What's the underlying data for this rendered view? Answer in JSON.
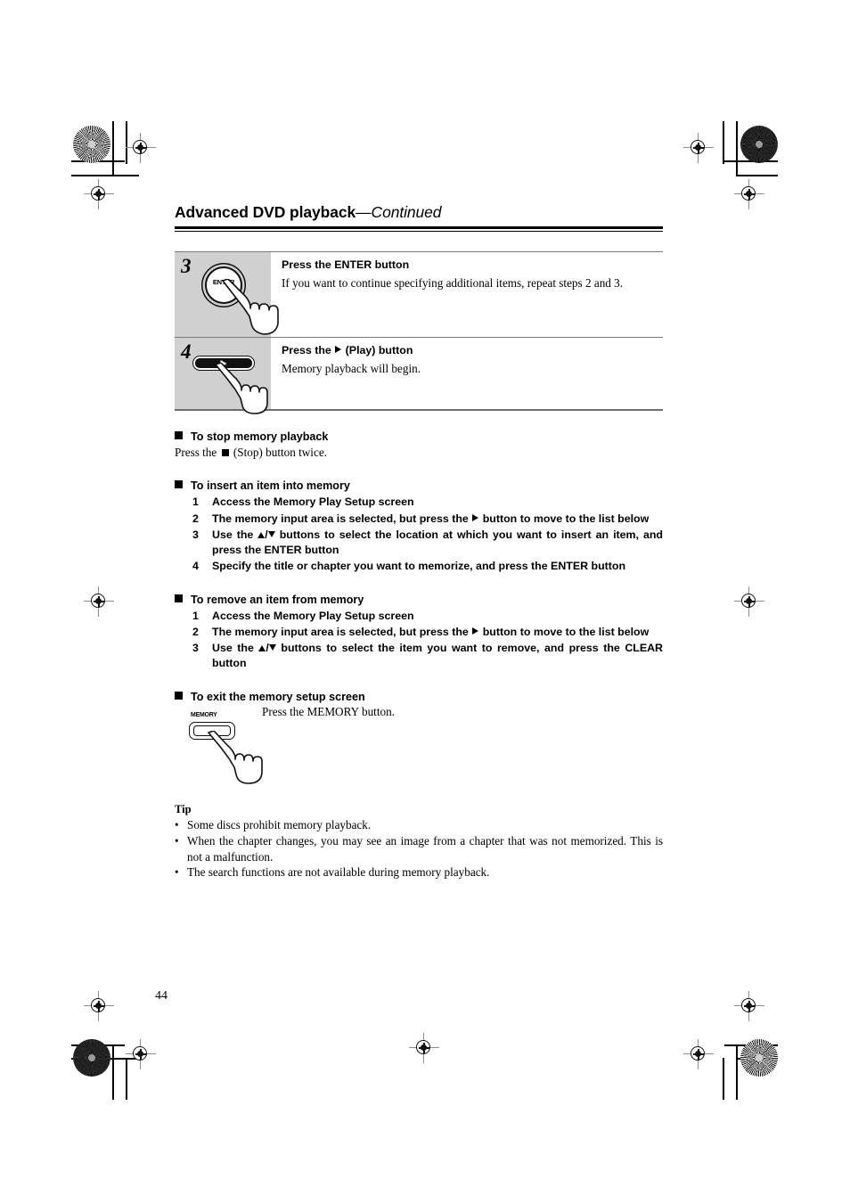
{
  "header": {
    "title": "Advanced DVD playback",
    "continued": "—Continued"
  },
  "steps": [
    {
      "number": "3",
      "title": "Press the ENTER button",
      "description": "If you want to continue specifying additional items, repeat steps 2 and 3.",
      "button_label": "ENTER"
    },
    {
      "number": "4",
      "title_prefix": "Press the ",
      "title_suffix": " (Play) button",
      "description": "Memory playback will begin."
    }
  ],
  "sections": [
    {
      "heading": "To stop memory playback",
      "body_prefix": "Press the ",
      "body_suffix": " (Stop) button twice."
    },
    {
      "heading": "To insert an item into memory",
      "items": [
        {
          "n": "1",
          "text": "Access the Memory Play Setup screen"
        },
        {
          "n": "2",
          "pre": "The memory input area is selected, but press the ",
          "post": " button to move to the list below",
          "glyph": "right-triangle"
        },
        {
          "n": "3",
          "pre": "Use the ",
          "post": " buttons to select the location at which you want to insert an item, and press the ENTER button",
          "glyph": "up-down-triangles"
        },
        {
          "n": "4",
          "text": "Specify the title or chapter you want to memorize, and press the ENTER button"
        }
      ]
    },
    {
      "heading": "To remove an item from memory",
      "items": [
        {
          "n": "1",
          "text": "Access the Memory Play Setup screen"
        },
        {
          "n": "2",
          "pre": "The memory input area is selected, but press the ",
          "post": " button to move to the list below",
          "glyph": "right-triangle"
        },
        {
          "n": "3",
          "pre": "Use the ",
          "post": " buttons to select the item you want to remove, and press the CLEAR button",
          "glyph": "up-down-triangles"
        }
      ]
    },
    {
      "heading": "To exit the memory setup screen",
      "memory_button_label": "MEMORY",
      "instruction": "Press the MEMORY button."
    }
  ],
  "tip": {
    "heading": "Tip",
    "bullet": "•",
    "items": [
      "Some discs prohibit memory playback.",
      "When the chapter changes, you may see an image from a chapter that was not memorized. This is not a malfunction.",
      "The search functions are not available during memory playback."
    ]
  },
  "page_number": "44",
  "colors": {
    "figure_background": "#d0d0d0",
    "rule": "#000000",
    "table_border": "#7a7a7a"
  }
}
